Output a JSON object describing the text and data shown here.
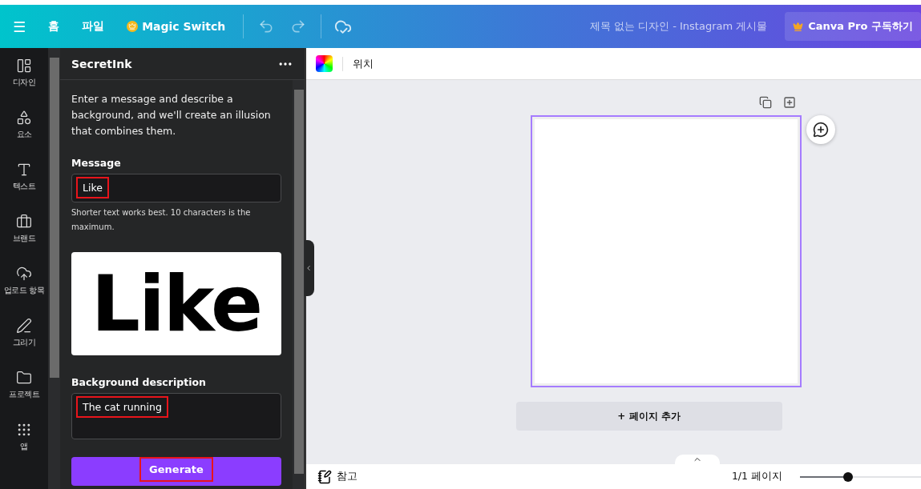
{
  "topbar": {
    "menu_icon": "☰",
    "items": [
      {
        "label": "홈",
        "kind": "text"
      },
      {
        "label": "파일",
        "kind": "text"
      },
      {
        "label": "Magic Switch",
        "kind": "crown"
      }
    ],
    "title": "제목 없는 디자인 - Instagram 게시물",
    "pro_button": "Canva Pro 구독하기"
  },
  "rail": [
    {
      "label": "디자인"
    },
    {
      "label": "요소"
    },
    {
      "label": "텍스트"
    },
    {
      "label": "브랜드"
    },
    {
      "label": "업로드 항목"
    },
    {
      "label": "그리기"
    },
    {
      "label": "프로젝트"
    },
    {
      "label": "앱"
    }
  ],
  "panel": {
    "title": "SecretInk",
    "intro": "Enter a message and describe a background, and we'll create an illusion that combines them.",
    "message_label": "Message",
    "message_value": "Like",
    "message_highlighted": true,
    "hint": "Shorter text works best. 10 characters is the maximum.",
    "preview_text": "Like",
    "background_label": "Background description",
    "background_value": "The cat running",
    "background_highlighted": true,
    "generate": "Generate",
    "generate_highlighted": true
  },
  "canvas": {
    "toolbar_label": "위치",
    "add_page": "+ 페이지 추가"
  },
  "bottom": {
    "notes": "참고",
    "page_count": "1/1 페이지",
    "zoom": {
      "level": 0.4
    }
  }
}
